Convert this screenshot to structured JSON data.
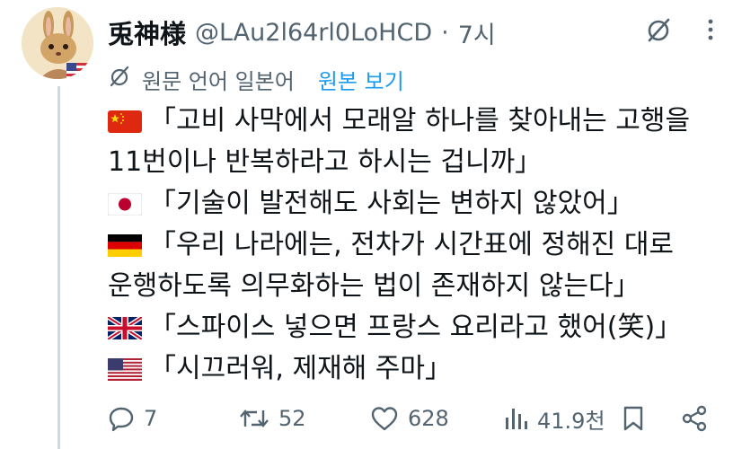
{
  "author": {
    "display_name": "兎神様",
    "handle": "@LAu2l64rl0LoHCD",
    "separator": "·",
    "time": "7시"
  },
  "translation": {
    "note": "원문 언어 일본어",
    "show_original": "원본 보기"
  },
  "body_lines": [
    {
      "flag": "china",
      "text": "「고비 사막에서 모래알 하나를 찾아내는 고행을"
    },
    {
      "flag": "",
      "text": "11번이나 반복하라고 하시는 겁니까」"
    },
    {
      "flag": "japan",
      "text": "「기술이 발전해도 사회는 변하지 않았어」"
    },
    {
      "flag": "germany",
      "text": "「우리 나라에는, 전차가 시간표에 정해진 대로"
    },
    {
      "flag": "",
      "text": "운행하도록 의무화하는 법이 존재하지 않는다」"
    },
    {
      "flag": "uk",
      "text": "「스파이스 넣으면 프랑스 요리라고 했어(笑)」"
    },
    {
      "flag": "usa",
      "text": "「시끄러워, 제재해 주마」"
    }
  ],
  "actions": {
    "replies": "7",
    "reposts": "52",
    "likes": "628",
    "views": "41.9천"
  },
  "icons": {
    "top": [
      "grok-icon",
      "more-icon"
    ],
    "translate": "translate-icon",
    "actions": [
      "reply-icon",
      "repost-icon",
      "like-icon",
      "views-icon",
      "bookmark-icon",
      "share-icon"
    ]
  },
  "colors": {
    "text": "#0f1419",
    "secondary": "#536471",
    "link": "#1d9bf0",
    "thread_line": "#cfd9de"
  }
}
